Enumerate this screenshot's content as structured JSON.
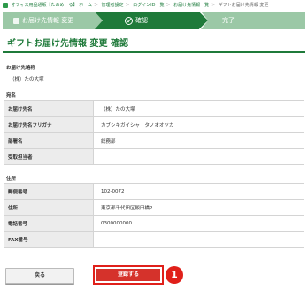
{
  "breadcrumb": {
    "items": [
      "オフィス用品通販【たのめーる】 ホーム",
      "管理者設定",
      "ログインID一覧",
      "お届け先情報一覧",
      "ギフトお届け先情報 変更"
    ],
    "separator": "＞"
  },
  "steps": {
    "step1": "お届け先情報 変更",
    "step2": "確認",
    "step3": "完了"
  },
  "page_title": "ギフトお届け先情報 変更 確認",
  "destination_code": {
    "label": "お届け先略称",
    "value": "（株）たの大塚"
  },
  "name_section": {
    "label": "宛名",
    "rows": [
      {
        "label": "お届け先名",
        "value": "（株）たの大塚"
      },
      {
        "label": "お届け先名フリガナ",
        "value": "カブシキガイシャ　タノオオツカ"
      },
      {
        "label": "部署名",
        "value": "総務部"
      },
      {
        "label": "受取担当者",
        "value": ""
      }
    ]
  },
  "address_section": {
    "label": "住所",
    "rows": [
      {
        "label": "郵便番号",
        "value": "102-0072"
      },
      {
        "label": "住所",
        "value": "東京都千代田区飯田橋2"
      },
      {
        "label": "電話番号",
        "value": "0300000000"
      },
      {
        "label": "FAX番号",
        "value": ""
      }
    ]
  },
  "buttons": {
    "back": "戻る",
    "submit": "登録する"
  },
  "marker": "1",
  "colors": {
    "brand_green": "#1f7a3a",
    "light_green": "#9bc8a6",
    "submit_red": "#d5322b"
  }
}
